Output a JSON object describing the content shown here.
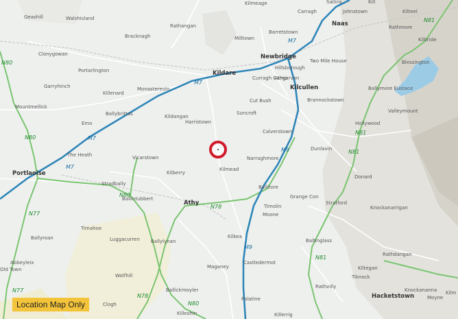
{
  "badge": "Location Map Only",
  "colors": {
    "background": "#eef0ee",
    "motorway": "#2f86b8",
    "national_road": "#7ac470",
    "marker": "#d11a2a",
    "badge": "#f3c33a"
  },
  "labels": {
    "geashill": "Geashill",
    "walshisland": "Walshisland",
    "rathangan": "Rathangan",
    "kilmeage": "Kilmeage",
    "sallins": "Sallins",
    "carragh": "Carragh",
    "johnstown": "Johnstown",
    "kill": "Kill",
    "kilteel": "Kilteel",
    "bracknagh": "Bracknagh",
    "clonygowan": "Clonygowan",
    "milltown": "Milltown",
    "barretstown": "Barretstown",
    "naas": "Naas",
    "rathmore": "Rathmore",
    "kilbride": "Kilbride",
    "portarlington": "Portarlington",
    "kildare": "Kildare",
    "newbridge": "Newbridge",
    "two_mile_house": "Two Mile House",
    "blessington": "Blessington",
    "garryhinch": "Garryhinch",
    "killenard": "Killenard",
    "monasterevin": "Monasterevin",
    "curragh_camp": "Curragh Camp",
    "hillsborough": "Hillsborough",
    "athgarvan": "Athgarvan",
    "mountmellick": "Mountmellick",
    "ballybrittas": "Ballybrittas",
    "cut_bush": "Cut Bush",
    "kilcullen": "Kilcullen",
    "brannockstown": "Brannockstown",
    "ballymore_eustace": "Ballymore Eustace",
    "valleymount": "Valleymount",
    "kildangan": "Kildangan",
    "harristown": "Harristown",
    "suncroft": "Suncroft",
    "emo": "Emo",
    "calverstown": "Calverstown",
    "hollywood": "Hollywood",
    "the_heath": "The Heath",
    "vicarstown": "Vicarstown",
    "narraghmore": "Narraghmore",
    "dunlavin": "Dunlavin",
    "kilmead": "Kilmead",
    "portlaoise": "Portlaoise",
    "kilberry": "Kilberry",
    "stradbally": "Stradbally",
    "donard": "Donard",
    "ballitore": "Ballitore",
    "ballintubbert": "Ballintubbert",
    "athy": "Athy",
    "grange_con": "Grange Con",
    "stratford": "Stratford",
    "knockanarrigan": "Knockanarrigan",
    "timolin": "Timolin",
    "moone": "Moone",
    "timahoe": "Timahoe",
    "ballyroan": "Ballyroan",
    "luggacurren": "Luggacurren",
    "ballylynan": "Ballylynan",
    "kilkea": "Kilkea",
    "baltinglass": "Baltinglass",
    "abbeyleix": "Abbeyleix",
    "old_town": "Old Town",
    "maganey": "Maganey",
    "castledermot": "Castledermot",
    "rathdangan": "Rathdangan",
    "wolfhill": "Wolfhill",
    "kiltegan": "Kiltegan",
    "tiknock": "Tiknock",
    "ballickmoyler": "Ballickmoyler",
    "rathvilly": "Rathvilly",
    "clogh": "Clogh",
    "palatine": "Palatine",
    "hacketstown": "Hacketstown",
    "knockananna": "Knockananna",
    "moyne": "Moyne",
    "killeshin": "Killeshin",
    "killerrig": "Killerrig",
    "kilmeague_edge": "Kilm"
  },
  "road_labels": {
    "m7_north": "M7",
    "m7_kildare": "M7",
    "m7_west": "M7",
    "m7_portlaoise": "M7",
    "m9_mid": "M9",
    "m9_south": "M9",
    "n81_north": "N81",
    "n81_mid": "N81",
    "n81_east": "N81",
    "n81_south": "N81",
    "n80_north": "N80",
    "n80_west": "N80",
    "n80_mid": "N80",
    "n80_south": "N80",
    "n77_a": "N77",
    "n77_b": "N77",
    "n78_mid": "N78",
    "n78_south": "N78"
  }
}
